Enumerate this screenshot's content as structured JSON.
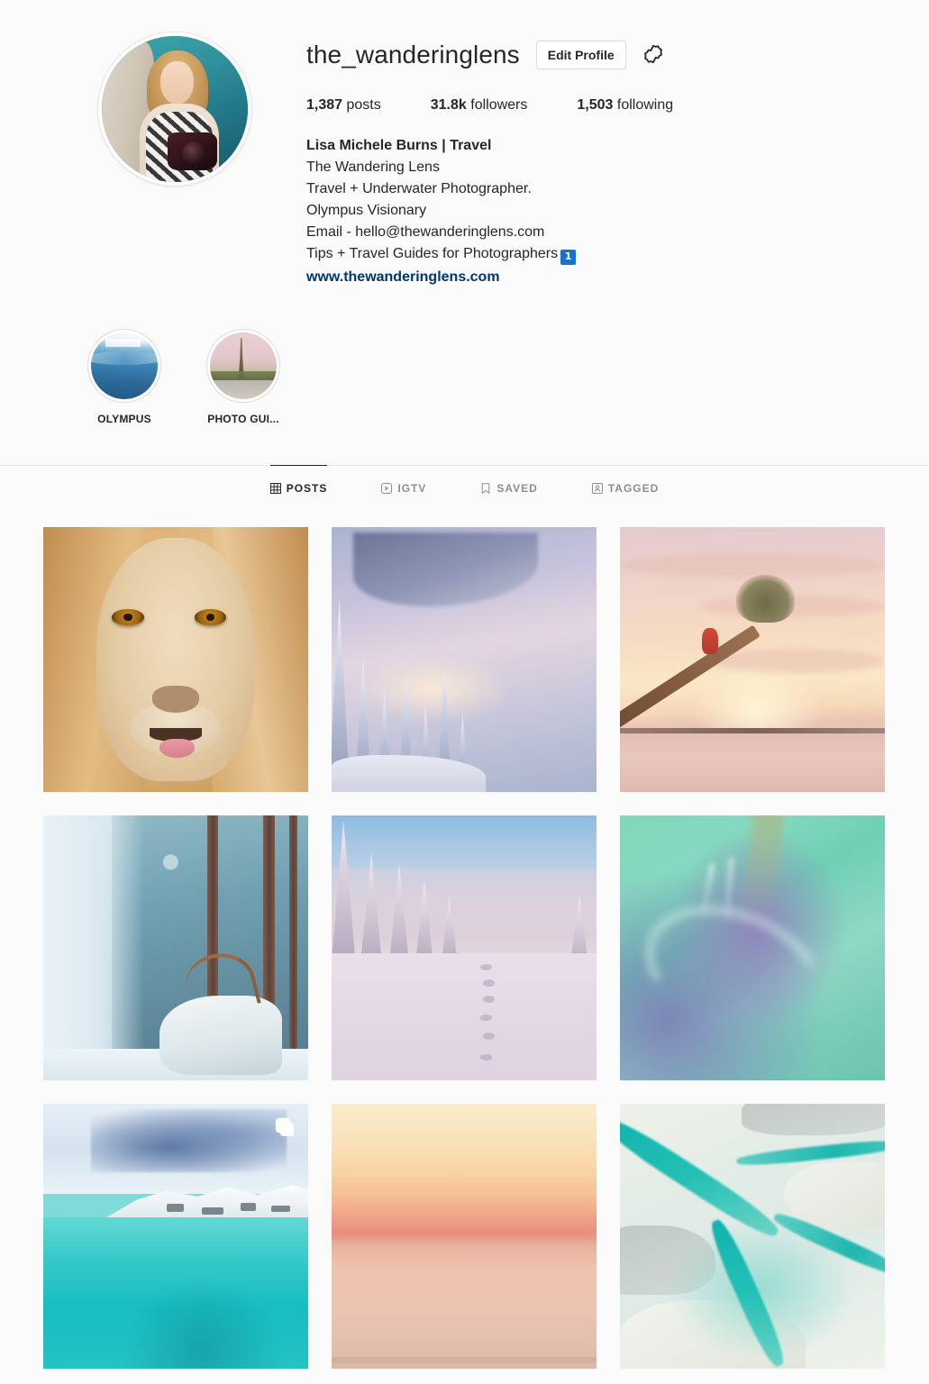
{
  "profile": {
    "username": "the_wanderinglens",
    "edit_profile_label": "Edit Profile",
    "avatar_alt": "Profile photo of a woman holding a camera by the ocean",
    "stats": {
      "posts_count": "1,387",
      "posts_label": "posts",
      "followers_count": "31.8k",
      "followers_label": "followers",
      "following_count": "1,503",
      "following_label": "following"
    },
    "bio": {
      "full_name": "Lisa Michele Burns | Travel",
      "lines": [
        "The Wandering Lens",
        "Travel + Underwater Photographer.",
        "Olympus Visionary",
        "Email - hello@thewanderinglens.com"
      ],
      "last_line": "Tips + Travel Guides for Photographers",
      "badge": "1",
      "website": "www.thewanderinglens.com"
    }
  },
  "highlights": [
    {
      "label": "OLYMPUS",
      "theme": "underwater-blue"
    },
    {
      "label": "PHOTO GUI...",
      "theme": "eiffel-tower-pink"
    }
  ],
  "tabs": [
    {
      "label": "POSTS",
      "icon": "grid-icon",
      "active": true
    },
    {
      "label": "IGTV",
      "icon": "igtv-icon",
      "active": false
    },
    {
      "label": "SAVED",
      "icon": "bookmark-icon",
      "active": false
    },
    {
      "label": "TAGGED",
      "icon": "tagged-person-icon",
      "active": false
    }
  ],
  "posts": [
    {
      "alt": "Close-up portrait of a lion with amber eyes",
      "theme": "lion",
      "multi": false
    },
    {
      "alt": "Snow-covered pine forest under lavender twilight sky",
      "theme": "snow-forest",
      "multi": false
    },
    {
      "alt": "Leaning palm tree at pastel sunset with person sitting on trunk",
      "theme": "palm-sunset",
      "multi": false
    },
    {
      "alt": "White reindeer with antlers in a snowy blue forest",
      "theme": "reindeer",
      "multi": false
    },
    {
      "alt": "Animal tracks across pink snow field with frosted trees",
      "theme": "snow-tracks",
      "multi": false
    },
    {
      "alt": "Green and purple aurora borealis",
      "theme": "aurora",
      "multi": false
    },
    {
      "alt": "Half underwater split shot of turquoise water and snowy mountain",
      "theme": "underwater-split",
      "multi": true
    },
    {
      "alt": "Minimal pastel sunset gradient over the sea",
      "theme": "sunset-gradient",
      "multi": false
    },
    {
      "alt": "Aerial view of turquoise tidal channels over white sand",
      "theme": "aerial-channels",
      "multi": false
    }
  ],
  "colors": {
    "background": "#fafafa",
    "text": "#262626",
    "muted": "#8e8e8e",
    "link": "#00376b",
    "border": "#dbdbdb",
    "badge_blue": "#1873cc"
  }
}
